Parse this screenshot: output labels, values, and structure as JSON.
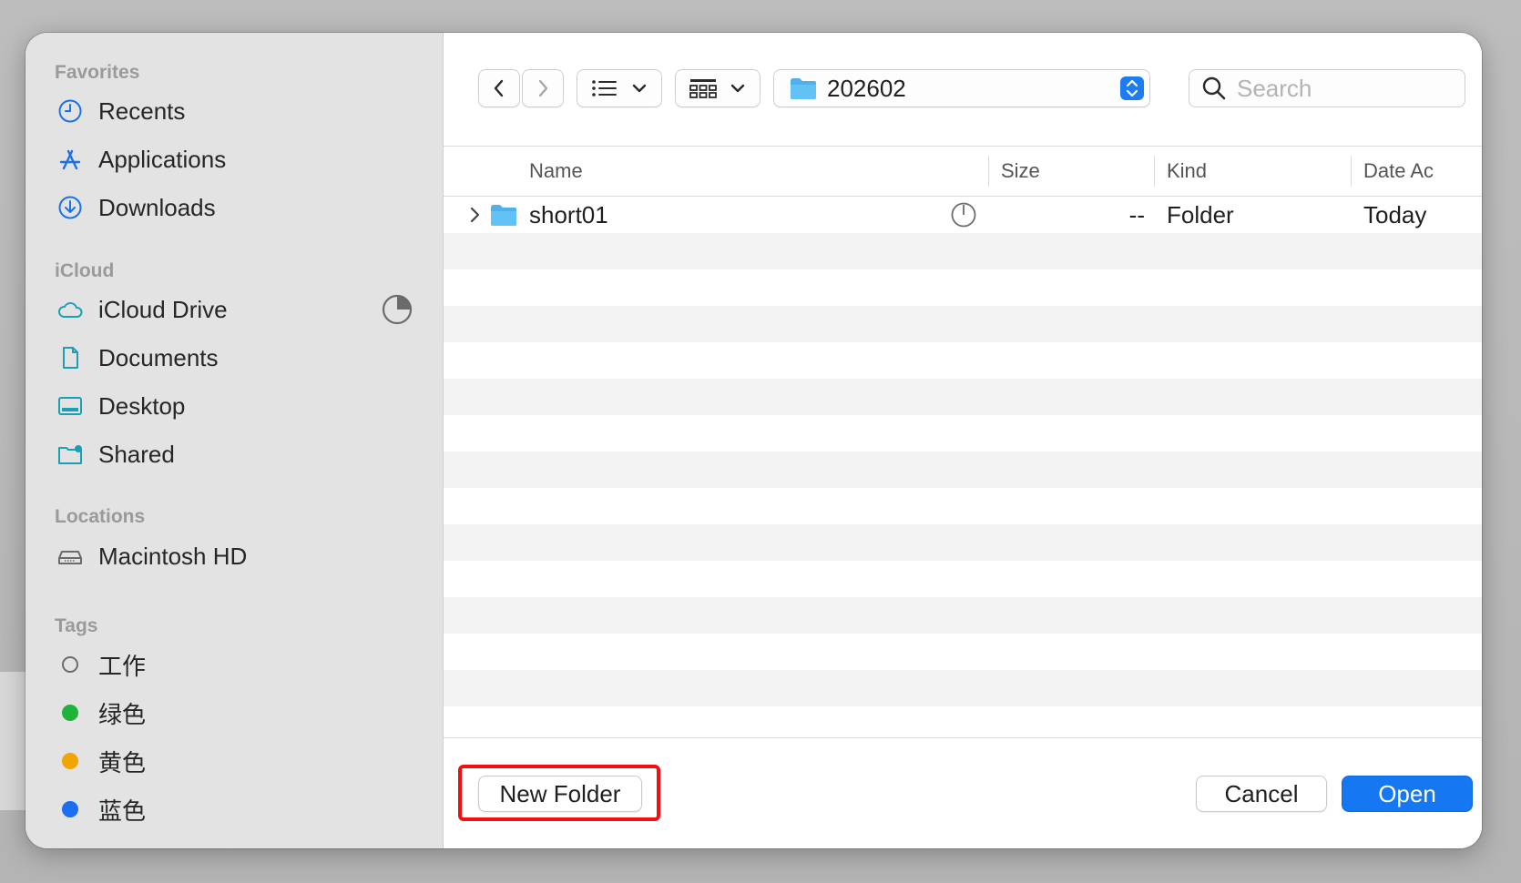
{
  "sidebar": {
    "favorites_title": "Favorites",
    "favorites": [
      {
        "label": "Recents",
        "icon": "clock-icon"
      },
      {
        "label": "Applications",
        "icon": "applications-icon"
      },
      {
        "label": "Downloads",
        "icon": "download-icon"
      }
    ],
    "icloud_title": "iCloud",
    "icloud": [
      {
        "label": "iCloud Drive",
        "icon": "cloud-icon"
      },
      {
        "label": "Documents",
        "icon": "document-icon"
      },
      {
        "label": "Desktop",
        "icon": "desktop-icon"
      },
      {
        "label": "Shared",
        "icon": "shared-folder-icon"
      }
    ],
    "locations_title": "Locations",
    "locations": [
      {
        "label": "Macintosh HD",
        "icon": "hard-drive-icon"
      }
    ],
    "tags_title": "Tags",
    "tags": [
      {
        "label": "工作",
        "color": "none"
      },
      {
        "label": "绿色",
        "color": "#1fb33a"
      },
      {
        "label": "黄色",
        "color": "#f0a500"
      },
      {
        "label": "蓝色",
        "color": "#1a6ef0"
      }
    ]
  },
  "toolbar": {
    "path_label": "202602",
    "search_placeholder": "Search"
  },
  "columns": {
    "name": "Name",
    "size": "Size",
    "kind": "Kind",
    "date": "Date Ac"
  },
  "files": [
    {
      "name": "short01",
      "size": "--",
      "kind": "Folder",
      "date": "Today"
    }
  ],
  "buttons": {
    "new_folder": "New Folder",
    "cancel": "Cancel",
    "open": "Open"
  },
  "colors": {
    "accent": "#1677f2",
    "highlight": "#ee1111",
    "sidebar_icon": "#1a72e8"
  }
}
